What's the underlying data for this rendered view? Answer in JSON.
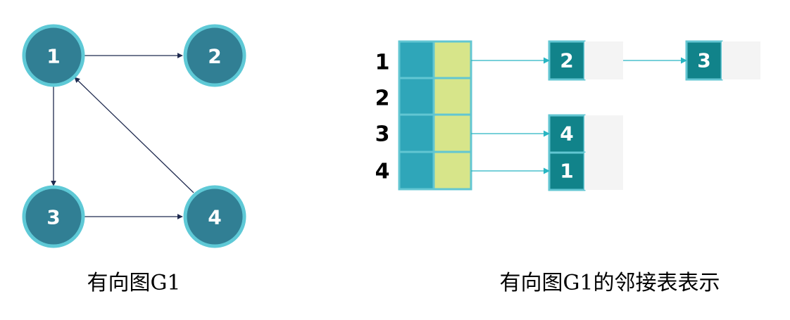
{
  "colors": {
    "node_fill": "#317f94",
    "node_ring": "#5ec9d6",
    "node_text": "#ffffff",
    "edge": "#1f2a4f",
    "array_index_cell": "#2fa6b9",
    "array_pointer_cell": "#d7e58a",
    "array_border": "#62c6d2",
    "list_value_cell": "#11838a",
    "list_next_cell": "#f4f4f4",
    "pointer_arrow": "#28b5c2",
    "text": "#000000"
  },
  "graph": {
    "nodes": [
      {
        "id": "1",
        "label": "1"
      },
      {
        "id": "2",
        "label": "2"
      },
      {
        "id": "3",
        "label": "3"
      },
      {
        "id": "4",
        "label": "4"
      }
    ],
    "edges": [
      {
        "from": "1",
        "to": "2"
      },
      {
        "from": "1",
        "to": "3"
      },
      {
        "from": "3",
        "to": "4"
      },
      {
        "from": "4",
        "to": "1"
      }
    ],
    "caption": "有向图G1"
  },
  "adjacency_list": {
    "rows": [
      {
        "label": "1",
        "list": [
          "2",
          "3"
        ]
      },
      {
        "label": "2",
        "list": []
      },
      {
        "label": "3",
        "list": [
          "4"
        ]
      },
      {
        "label": "4",
        "list": [
          "1"
        ]
      }
    ],
    "caption": "有向图G1的邻接表表示"
  }
}
